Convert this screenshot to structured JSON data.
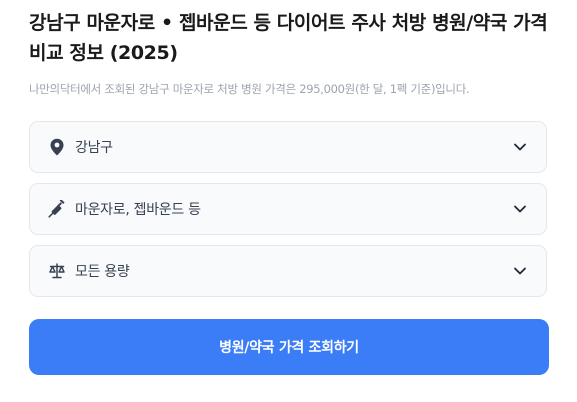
{
  "page": {
    "title": "강남구 마운자로 • 젭바운드 등 다이어트 주사 처방 병원/약국 가격 비교 정보 (2025)",
    "subtitle": "나만의닥터에서 조회된 강남구 마운자로 처방 병원 가격은 295,000원(한 달, 1펙 기준)입니다."
  },
  "filters": {
    "region": {
      "value": "강남구",
      "icon": "location-pin-icon"
    },
    "drug": {
      "value": "마운자로, 젭바운드 등",
      "icon": "syringe-icon"
    },
    "dose": {
      "value": "모든 용량",
      "icon": "scale-icon"
    }
  },
  "cta": {
    "label": "병원/약국 가격 조회하기",
    "color": "#3b7cf7"
  }
}
